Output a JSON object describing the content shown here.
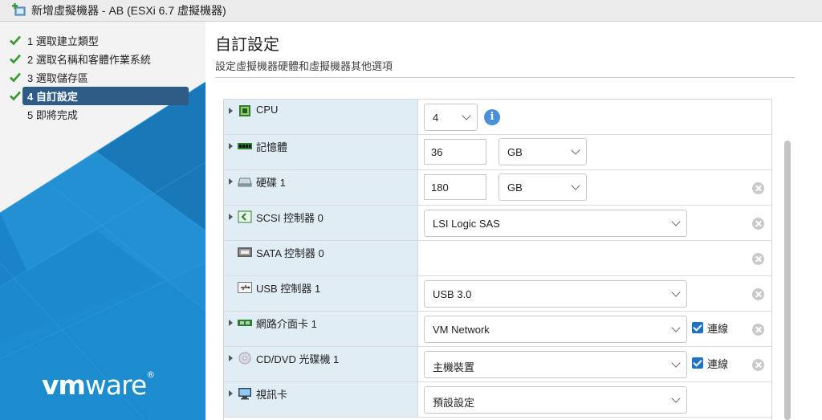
{
  "window": {
    "title": "新增虛擬機器 - AB (ESXi 6.7 虛擬機器)"
  },
  "wizard": {
    "steps": [
      {
        "label": "1 選取建立類型",
        "state": "done"
      },
      {
        "label": "2 選取名稱和客體作業系統",
        "state": "done"
      },
      {
        "label": "3 選取儲存區",
        "state": "done"
      },
      {
        "label": "4 自訂設定",
        "state": "active"
      },
      {
        "label": "5 即將完成",
        "state": "pending"
      }
    ],
    "brand": {
      "vm": "vm",
      "ware": "ware"
    }
  },
  "page": {
    "title": "自訂設定",
    "subtitle": "設定虛擬機器硬體和虛擬機器其他選項"
  },
  "hardware": {
    "cpu": {
      "label": "CPU",
      "value": "4",
      "icon": "cpu-icon"
    },
    "memory": {
      "label": "記憶體",
      "value": "36",
      "unit": "GB",
      "icon": "memory-icon"
    },
    "disk": {
      "label": "硬碟 1",
      "value": "180",
      "unit": "GB",
      "icon": "hard-disk-icon"
    },
    "scsi": {
      "label": "SCSI 控制器 0",
      "value": "LSI Logic SAS",
      "icon": "scsi-controller-icon"
    },
    "sata": {
      "label": "SATA 控制器 0",
      "icon": "sata-controller-icon"
    },
    "usb": {
      "label": "USB 控制器 1",
      "value": "USB 3.0",
      "icon": "usb-icon"
    },
    "nic": {
      "label": "網路介面卡 1",
      "value": "VM Network",
      "connect_label": "連線",
      "connected": true,
      "icon": "network-card-icon"
    },
    "cdrom": {
      "label": "CD/DVD 光碟機 1",
      "value": "主機裝置",
      "connect_label": "連線",
      "connected": true,
      "icon": "cd-dvd-icon"
    },
    "video": {
      "label": "視訊卡",
      "value": "預設設定",
      "icon": "monitor-icon"
    }
  },
  "colors": {
    "active_step": "#2f5c86",
    "check_green": "#3d9b35",
    "info_blue": "#4a90d9",
    "checkbox_blue": "#1e73c8",
    "label_cell": "#e1edf5"
  }
}
